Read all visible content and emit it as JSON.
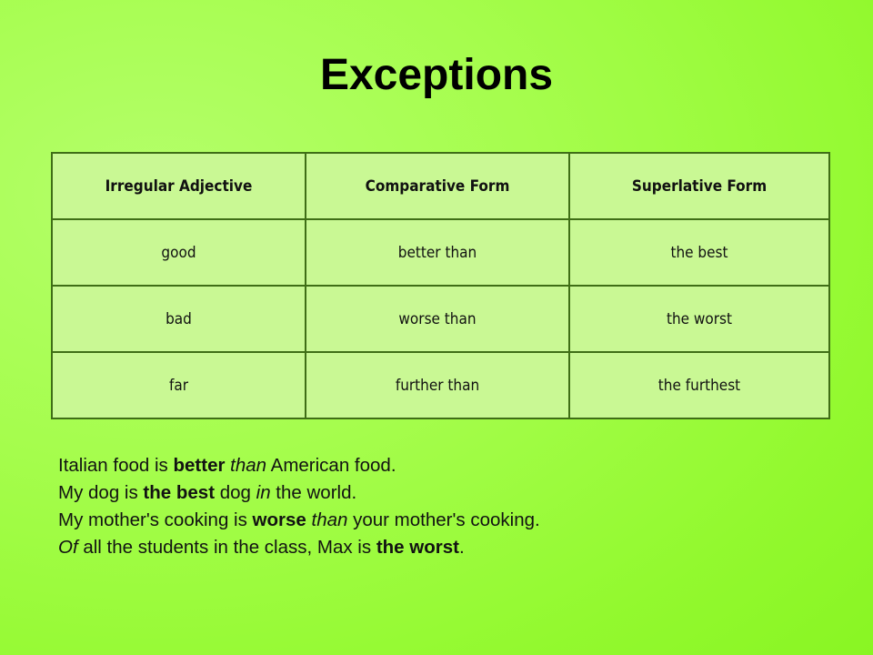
{
  "slide": {
    "title": "Exceptions",
    "background_color": "#9dfc3e",
    "table_fill_color": "#c9f894",
    "table_border_color": "#3f6e16",
    "text_color": "#111111"
  },
  "table": {
    "headers": [
      "Irregular Adjective",
      "Comparative Form",
      "Superlative Form"
    ],
    "rows": [
      {
        "adjective": "good",
        "comparative": "better than",
        "superlative": "the best"
      },
      {
        "adjective": "bad",
        "comparative": "worse than",
        "superlative": "the worst"
      },
      {
        "adjective": "far",
        "comparative": "further than",
        "superlative": "the furthest"
      }
    ]
  },
  "examples": [
    {
      "segments": [
        {
          "text": "Italian food is ",
          "style": "normal"
        },
        {
          "text": "better",
          "style": "bold"
        },
        {
          "text": " ",
          "style": "normal"
        },
        {
          "text": "than",
          "style": "italic"
        },
        {
          "text": " American food.",
          "style": "normal"
        }
      ]
    },
    {
      "segments": [
        {
          "text": "My dog is ",
          "style": "normal"
        },
        {
          "text": "the best",
          "style": "bold"
        },
        {
          "text": " dog ",
          "style": "normal"
        },
        {
          "text": "in",
          "style": "italic"
        },
        {
          "text": " the world.",
          "style": "normal"
        }
      ]
    },
    {
      "segments": [
        {
          "text": "My mother's cooking is ",
          "style": "normal"
        },
        {
          "text": "worse",
          "style": "bold"
        },
        {
          "text": " ",
          "style": "normal"
        },
        {
          "text": "than",
          "style": "italic"
        },
        {
          "text": " your mother's cooking.",
          "style": "normal"
        }
      ]
    },
    {
      "segments": [
        {
          "text": "Of",
          "style": "italic"
        },
        {
          "text": " all the students in the class, Max is ",
          "style": "normal"
        },
        {
          "text": "the worst",
          "style": "bold"
        },
        {
          "text": ".",
          "style": "normal"
        }
      ]
    }
  ]
}
